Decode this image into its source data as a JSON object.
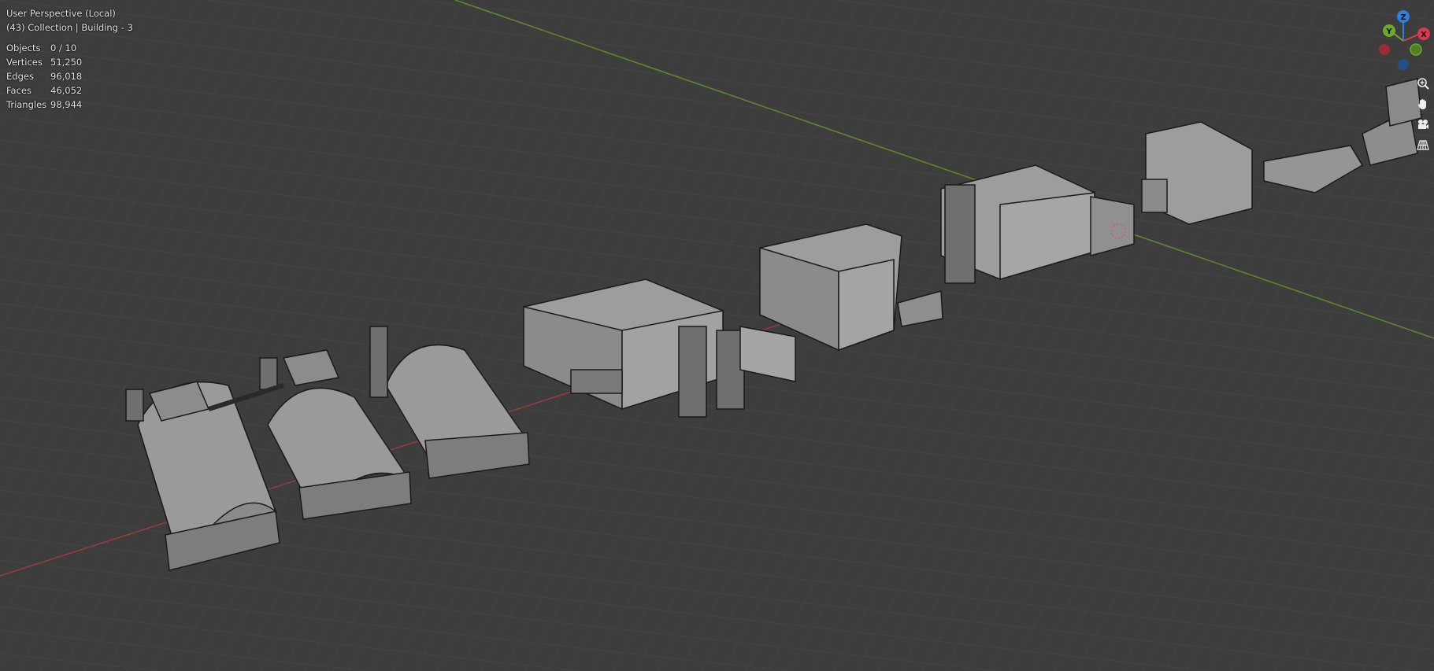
{
  "viewport": {
    "perspective_label": "User Perspective (Local)",
    "collection_label": "(43) Collection | Building - 3"
  },
  "stats": [
    {
      "label": "Objects",
      "value": "0 / 10"
    },
    {
      "label": "Vertices",
      "value": "51,250"
    },
    {
      "label": "Edges",
      "value": "96,018"
    },
    {
      "label": "Faces",
      "value": "46,052"
    },
    {
      "label": "Triangles",
      "value": "98,944"
    }
  ],
  "gizmo": {
    "z_label": "Z",
    "y_label": "Y",
    "x_label": "X",
    "z_color": "#2f7fe0",
    "y_color": "#6bab2c",
    "x_color": "#e0364f"
  },
  "nav_tools": [
    "zoom-icon",
    "pan-hand-icon",
    "camera-icon",
    "grid-perspective-icon"
  ],
  "colors": {
    "background": "#3d3d3d",
    "grid": "#484848",
    "x_axis": "#9b3b3b",
    "y_axis": "#5e8a2e",
    "building": "#8f8f8f"
  }
}
